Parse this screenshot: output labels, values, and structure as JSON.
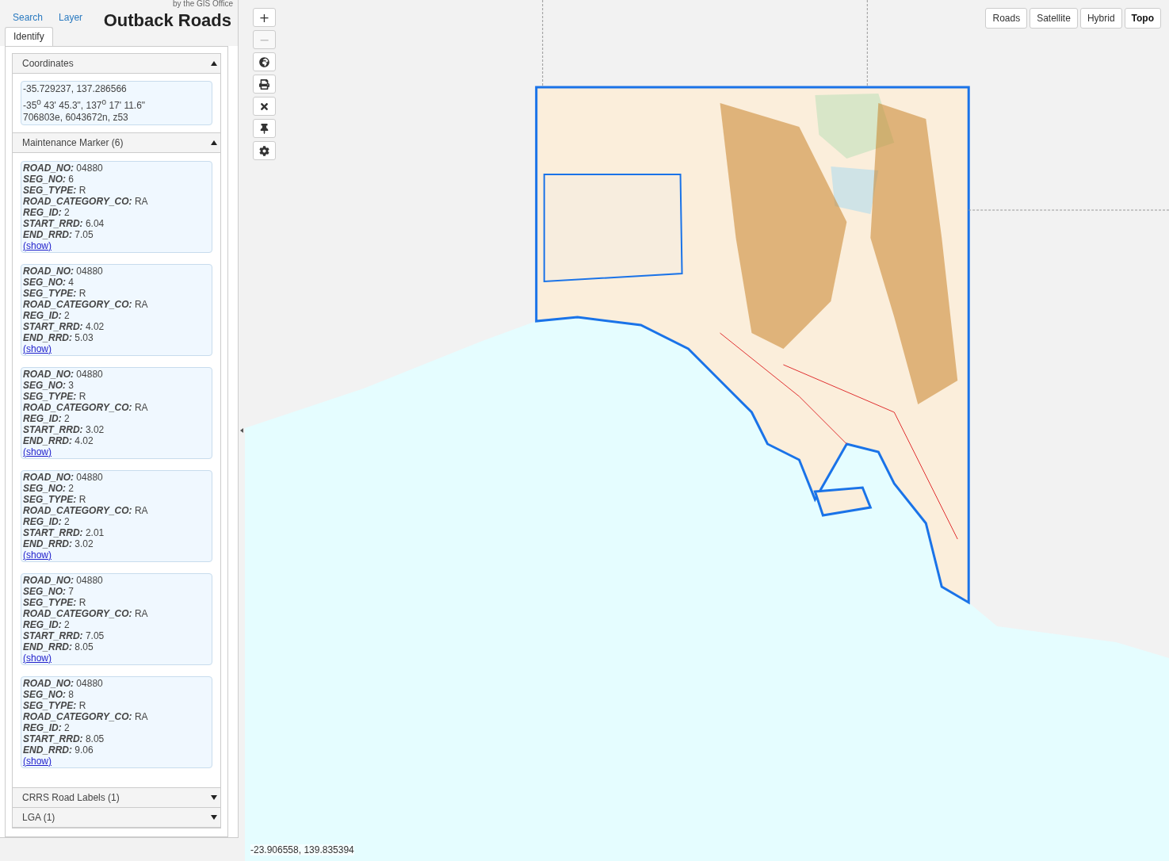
{
  "header": {
    "credit": "by the GIS Office",
    "title": "Outback Roads"
  },
  "tabs": [
    {
      "label": "Search",
      "selected": false
    },
    {
      "label": "Layer",
      "selected": false
    },
    {
      "label": "Identify",
      "selected": true
    }
  ],
  "sections": [
    {
      "kind": "coordinates",
      "title": "Coordinates",
      "expanded": true,
      "lines": [
        "-35.729237, 137.286566",
        "-35$^{o}$ 43' 45.3\", 137$^{o}$ 17' 11.6\"",
        "706803e, 6043672n, z53"
      ]
    },
    {
      "kind": "records",
      "title": "Maintenance Marker (6)",
      "expanded": true,
      "records": [
        {
          "fields": [
            {
              "key": "ROAD_NO:",
              "value": "04880"
            },
            {
              "key": "SEG_NO:",
              "value": "6"
            },
            {
              "key": "SEG_TYPE:",
              "value": "R"
            },
            {
              "key": "ROAD_CATEGORY_CO:",
              "value": "RA"
            },
            {
              "key": "REG_ID:",
              "value": "2"
            },
            {
              "key": "START_RRD:",
              "value": "6.04"
            },
            {
              "key": "END_RRD:",
              "value": "7.05"
            }
          ],
          "link": "(show)"
        },
        {
          "fields": [
            {
              "key": "ROAD_NO:",
              "value": "04880"
            },
            {
              "key": "SEG_NO:",
              "value": "4"
            },
            {
              "key": "SEG_TYPE:",
              "value": "R"
            },
            {
              "key": "ROAD_CATEGORY_CO:",
              "value": "RA"
            },
            {
              "key": "REG_ID:",
              "value": "2"
            },
            {
              "key": "START_RRD:",
              "value": "4.02"
            },
            {
              "key": "END_RRD:",
              "value": "5.03"
            }
          ],
          "link": "(show)"
        },
        {
          "fields": [
            {
              "key": "ROAD_NO:",
              "value": "04880"
            },
            {
              "key": "SEG_NO:",
              "value": "3"
            },
            {
              "key": "SEG_TYPE:",
              "value": "R"
            },
            {
              "key": "ROAD_CATEGORY_CO:",
              "value": "RA"
            },
            {
              "key": "REG_ID:",
              "value": "2"
            },
            {
              "key": "START_RRD:",
              "value": "3.02"
            },
            {
              "key": "END_RRD:",
              "value": "4.02"
            }
          ],
          "link": "(show)"
        },
        {
          "fields": [
            {
              "key": "ROAD_NO:",
              "value": "04880"
            },
            {
              "key": "SEG_NO:",
              "value": "2"
            },
            {
              "key": "SEG_TYPE:",
              "value": "R"
            },
            {
              "key": "ROAD_CATEGORY_CO:",
              "value": "RA"
            },
            {
              "key": "REG_ID:",
              "value": "2"
            },
            {
              "key": "START_RRD:",
              "value": "2.01"
            },
            {
              "key": "END_RRD:",
              "value": "3.02"
            }
          ],
          "link": "(show)"
        },
        {
          "fields": [
            {
              "key": "ROAD_NO:",
              "value": "04880"
            },
            {
              "key": "SEG_NO:",
              "value": "7"
            },
            {
              "key": "SEG_TYPE:",
              "value": "R"
            },
            {
              "key": "ROAD_CATEGORY_CO:",
              "value": "RA"
            },
            {
              "key": "REG_ID:",
              "value": "2"
            },
            {
              "key": "START_RRD:",
              "value": "7.05"
            },
            {
              "key": "END_RRD:",
              "value": "8.05"
            }
          ],
          "link": "(show)"
        },
        {
          "fields": [
            {
              "key": "ROAD_NO:",
              "value": "04880"
            },
            {
              "key": "SEG_NO:",
              "value": "8"
            },
            {
              "key": "SEG_TYPE:",
              "value": "R"
            },
            {
              "key": "ROAD_CATEGORY_CO:",
              "value": "RA"
            },
            {
              "key": "REG_ID:",
              "value": "2"
            },
            {
              "key": "START_RRD:",
              "value": "8.05"
            },
            {
              "key": "END_RRD:",
              "value": "9.06"
            }
          ],
          "link": "(show)"
        }
      ]
    },
    {
      "title": "CRRS Road Labels (1)",
      "expanded": false
    },
    {
      "title": "LGA (1)",
      "expanded": false
    }
  ],
  "map": {
    "controls": [
      {
        "kind": "zoom-in",
        "label": "+",
        "disabled": false
      },
      {
        "kind": "zoom-out",
        "label": "−",
        "disabled": true
      },
      {
        "kind": "globe",
        "disabled": false
      },
      {
        "kind": "print",
        "disabled": false
      },
      {
        "kind": "clear",
        "disabled": false
      },
      {
        "kind": "pin",
        "disabled": false
      },
      {
        "kind": "settings",
        "disabled": false
      }
    ],
    "basemaps": [
      {
        "label": "Roads",
        "selected": false
      },
      {
        "label": "Satellite",
        "selected": false
      },
      {
        "label": "Hybrid",
        "selected": false
      },
      {
        "label": "Topo",
        "selected": true
      }
    ],
    "cursor_coordinates": "-23.906558, 139.835394"
  }
}
